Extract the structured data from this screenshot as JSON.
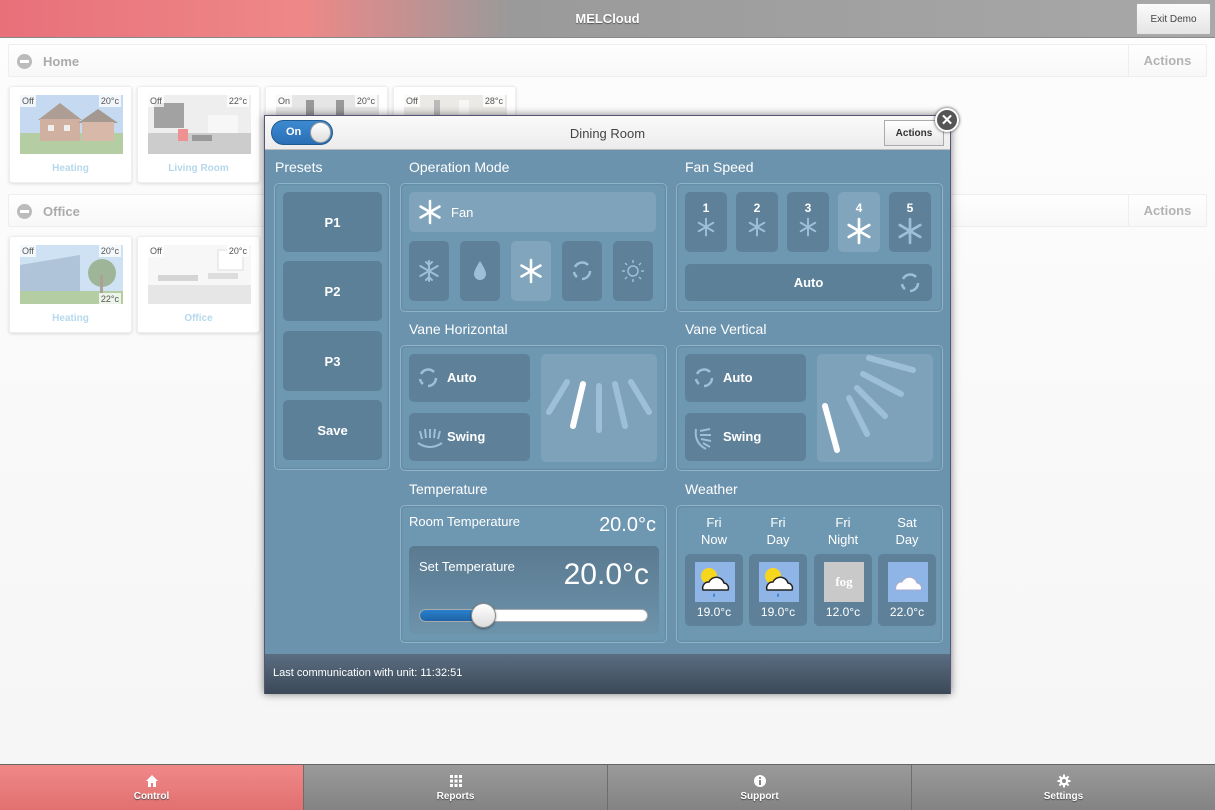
{
  "app": {
    "title": "MELCloud",
    "exit_label": "Exit Demo"
  },
  "groups": [
    {
      "name": "Home",
      "actions": "Actions",
      "tiles": [
        {
          "status": "Off",
          "temp": "20°c",
          "label": "Heating"
        },
        {
          "status": "Off",
          "temp": "22°c",
          "label": "Living Room"
        },
        {
          "status": "On",
          "temp": "20°c",
          "label": ""
        },
        {
          "status": "Off",
          "temp": "28°c",
          "label": ""
        }
      ]
    },
    {
      "name": "Office",
      "actions": "Actions",
      "tiles": [
        {
          "status": "Off",
          "temp": "20°c",
          "temp2": "22°c",
          "label": "Heating"
        },
        {
          "status": "Off",
          "temp": "20°c",
          "label": "Office"
        }
      ]
    }
  ],
  "dialog": {
    "title": "Dining Room",
    "power_label": "On",
    "actions_label": "Actions",
    "close_glyph": "✕",
    "presets": {
      "title": "Presets",
      "items": [
        "P1",
        "P2",
        "P3",
        "Save"
      ]
    },
    "operation_mode": {
      "title": "Operation Mode",
      "current": "Fan",
      "modes": [
        "snowflake-icon",
        "drop-icon",
        "fan-icon",
        "auto-icon",
        "sun-icon"
      ],
      "selected_index": 2
    },
    "fan_speed": {
      "title": "Fan Speed",
      "speeds": [
        "1",
        "2",
        "3",
        "4",
        "5"
      ],
      "selected": "4",
      "auto_label": "Auto"
    },
    "vane_horizontal": {
      "title": "Vane Horizontal",
      "auto_label": "Auto",
      "swing_label": "Swing"
    },
    "vane_vertical": {
      "title": "Vane Vertical",
      "auto_label": "Auto",
      "swing_label": "Swing"
    },
    "temperature": {
      "title": "Temperature",
      "room_label": "Room Temperature",
      "room_value": "20.0°c",
      "set_label": "Set Temperature",
      "set_value": "20.0°c",
      "slider_fraction": 0.28
    },
    "weather": {
      "title": "Weather",
      "forecast": [
        {
          "day": "Fri",
          "period": "Now",
          "icon": "sun-cloud-rain-icon",
          "temp": "19.0°c"
        },
        {
          "day": "Fri",
          "period": "Day",
          "icon": "sun-cloud-rain-icon",
          "temp": "19.0°c"
        },
        {
          "day": "Fri",
          "period": "Night",
          "icon": "fog-icon",
          "icon_text": "fog",
          "temp": "12.0°c"
        },
        {
          "day": "Sat",
          "period": "Day",
          "icon": "cloud-icon",
          "temp": "22.0°c"
        }
      ]
    },
    "footer": "Last communication with unit: 11:32:51"
  },
  "nav": [
    {
      "label": "Control",
      "icon": "home-icon",
      "active": true
    },
    {
      "label": "Reports",
      "icon": "grid-icon"
    },
    {
      "label": "Support",
      "icon": "info-icon"
    },
    {
      "label": "Settings",
      "icon": "gear-icon"
    }
  ],
  "colors": {
    "accent": "#e87a80",
    "panel": "#6b93ad",
    "toggle": "#2f7cc2"
  }
}
